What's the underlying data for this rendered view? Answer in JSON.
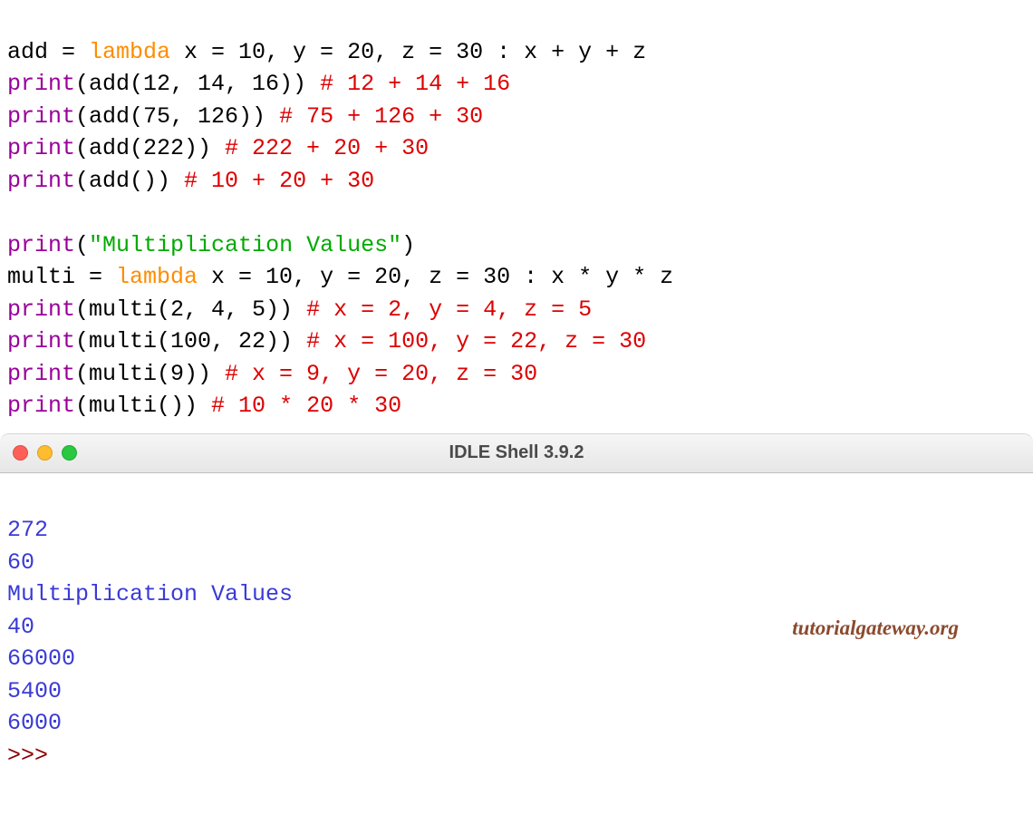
{
  "code": {
    "line1": {
      "assign_pre": "add = ",
      "kw": "lambda",
      "rest": " x = 10, y = 20, z = 30 : x + y + z"
    },
    "line2": {
      "fn": "print",
      "args": "(add(12, 14, 16)) ",
      "comment": "# 12 + 14 + 16"
    },
    "line3": {
      "fn": "print",
      "args": "(add(75, 126)) ",
      "comment": "# 75 + 126 + 30"
    },
    "line4": {
      "fn": "print",
      "args": "(add(222)) ",
      "comment": "# 222 + 20 + 30"
    },
    "line5": {
      "fn": "print",
      "args": "(add()) ",
      "comment": "# 10 + 20 + 30"
    },
    "blank1": "",
    "line7": {
      "fn": "print",
      "lparen": "(",
      "str": "\"Multiplication Values\"",
      "rparen": ")"
    },
    "line8": {
      "assign_pre": "multi = ",
      "kw": "lambda",
      "rest": " x = 10, y = 20, z = 30 : x * y * z"
    },
    "line9": {
      "fn": "print",
      "args": "(multi(2, 4, 5)) ",
      "comment": "# x = 2, y = 4, z = 5"
    },
    "line10": {
      "fn": "print",
      "args": "(multi(100, 22)) ",
      "comment": "# x = 100, y = 22, z = 30"
    },
    "line11": {
      "fn": "print",
      "args": "(multi(9)) ",
      "comment": "# x = 9, y = 20, z = 30"
    },
    "line12": {
      "fn": "print",
      "args": "(multi()) ",
      "comment": "# 10 * 20 * 30"
    }
  },
  "window": {
    "title": "IDLE Shell 3.9.2"
  },
  "shell": {
    "lines": [
      "272",
      "60",
      "Multiplication Values",
      "40",
      "66000",
      "5400",
      "6000"
    ],
    "prompt": ">>> "
  },
  "watermark": "tutorialgateway.org"
}
